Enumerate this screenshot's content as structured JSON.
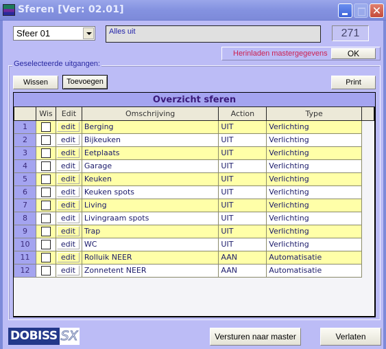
{
  "window": {
    "title": "Sferen  [Ver: 02.01]",
    "close_glyph": "✕"
  },
  "top": {
    "sfeer_select": "Sfeer 01",
    "description": "Alles uit",
    "count": "271",
    "reload_label": "Herinladen mastergegevens",
    "ok_label": "OK"
  },
  "group": {
    "label": "Geselecteerde uitgangen:",
    "wissen_label": "Wissen",
    "toevoegen_label": "Toevoegen",
    "print_label": "Print"
  },
  "grid": {
    "title": "Overzicht sferen",
    "columns": [
      "",
      "Wis",
      "Edit",
      "Omschrijving",
      "Action",
      "Type"
    ],
    "edit_label": "edit",
    "rows": [
      {
        "nr": "1",
        "wis": false,
        "omschrijving": "Berging",
        "action": "UIT",
        "type": "Verlichting"
      },
      {
        "nr": "2",
        "wis": false,
        "omschrijving": "Bijkeuken",
        "action": "UIT",
        "type": "Verlichting"
      },
      {
        "nr": "3",
        "wis": false,
        "omschrijving": "Eetplaats",
        "action": "UIT",
        "type": "Verlichting"
      },
      {
        "nr": "4",
        "wis": false,
        "omschrijving": "Garage",
        "action": "UIT",
        "type": "Verlichting"
      },
      {
        "nr": "5",
        "wis": false,
        "omschrijving": "Keuken",
        "action": "UIT",
        "type": "Verlichting"
      },
      {
        "nr": "6",
        "wis": false,
        "omschrijving": "Keuken spots",
        "action": "UIT",
        "type": "Verlichting"
      },
      {
        "nr": "7",
        "wis": false,
        "omschrijving": "Living",
        "action": "UIT",
        "type": "Verlichting"
      },
      {
        "nr": "8",
        "wis": false,
        "omschrijving": "Livingraam spots",
        "action": "UIT",
        "type": "Verlichting"
      },
      {
        "nr": "9",
        "wis": false,
        "omschrijving": "Trap",
        "action": "UIT",
        "type": "Verlichting"
      },
      {
        "nr": "10",
        "wis": false,
        "omschrijving": "WC",
        "action": "UIT",
        "type": "Verlichting"
      },
      {
        "nr": "11",
        "wis": false,
        "omschrijving": "Rolluik NEER",
        "action": "AAN",
        "type": "Automatisatie"
      },
      {
        "nr": "12",
        "wis": false,
        "omschrijving": "Zonnetent NEER",
        "action": "AAN",
        "type": "Automatisatie"
      }
    ]
  },
  "footer": {
    "logo_main": "DOBISS",
    "logo_sx": "SX",
    "send_label": "Versturen naar master",
    "leave_label": "Verlaten"
  }
}
